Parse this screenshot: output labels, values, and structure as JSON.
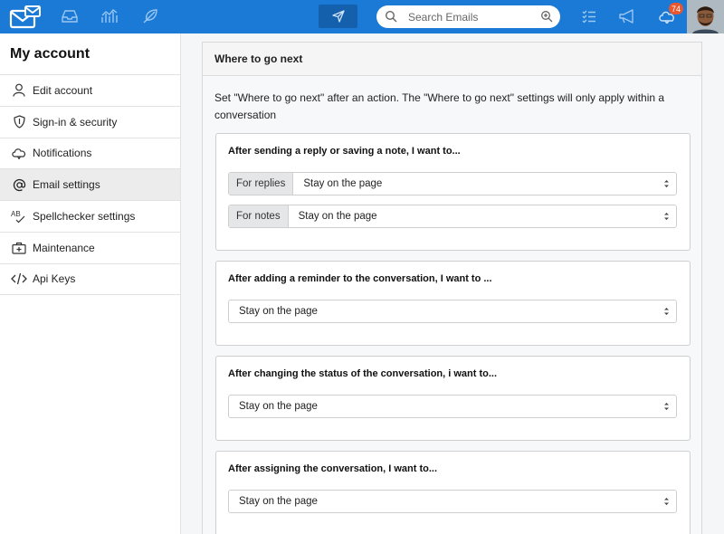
{
  "header": {
    "search_placeholder": "Search Emails",
    "notification_count": "74",
    "icons": [
      "mail-logo-icon",
      "inbox-icon",
      "reports-icon",
      "feather-icon",
      "send-icon",
      "search-icon",
      "zoom-icon",
      "tasks-icon",
      "megaphone-icon",
      "cloud-icon",
      "user-avatar"
    ]
  },
  "sidebar": {
    "title": "My account",
    "items": [
      {
        "label": "Edit account",
        "icon": "user-icon"
      },
      {
        "label": "Sign-in & security",
        "icon": "shield-icon"
      },
      {
        "label": "Notifications",
        "icon": "cloud-bell-icon"
      },
      {
        "label": "Email settings",
        "icon": "at-icon",
        "active": true
      },
      {
        "label": "Spellchecker settings",
        "icon": "spellcheck-icon"
      },
      {
        "label": "Maintenance",
        "icon": "medkit-icon"
      },
      {
        "label": "Api Keys",
        "icon": "code-icon"
      }
    ]
  },
  "main": {
    "panel_title": "Where to go next",
    "description": "Set \"Where to go next\" after an action. The \"Where to go next\" settings will only apply within a conversation",
    "cards": [
      {
        "title": "After sending a reply or saving a note, I want to...",
        "selects": [
          {
            "prefix": "For replies",
            "value": "Stay on the page"
          },
          {
            "prefix": "For notes",
            "value": "Stay on the page"
          }
        ]
      },
      {
        "title": "After adding a reminder to the conversation, I want to ...",
        "selects": [
          {
            "prefix": "",
            "value": "Stay on the page"
          }
        ]
      },
      {
        "title": "After changing the status of the conversation, i want to...",
        "selects": [
          {
            "prefix": "",
            "value": "Stay on the page"
          }
        ]
      },
      {
        "title": "After assigning the conversation, I want to...",
        "selects": [
          {
            "prefix": "",
            "value": "Stay on the page"
          }
        ]
      }
    ]
  },
  "colors": {
    "topbar": "#1a7ad6",
    "compose": "#1560ad",
    "badge": "#e8572f",
    "active_item": "#ececec"
  }
}
